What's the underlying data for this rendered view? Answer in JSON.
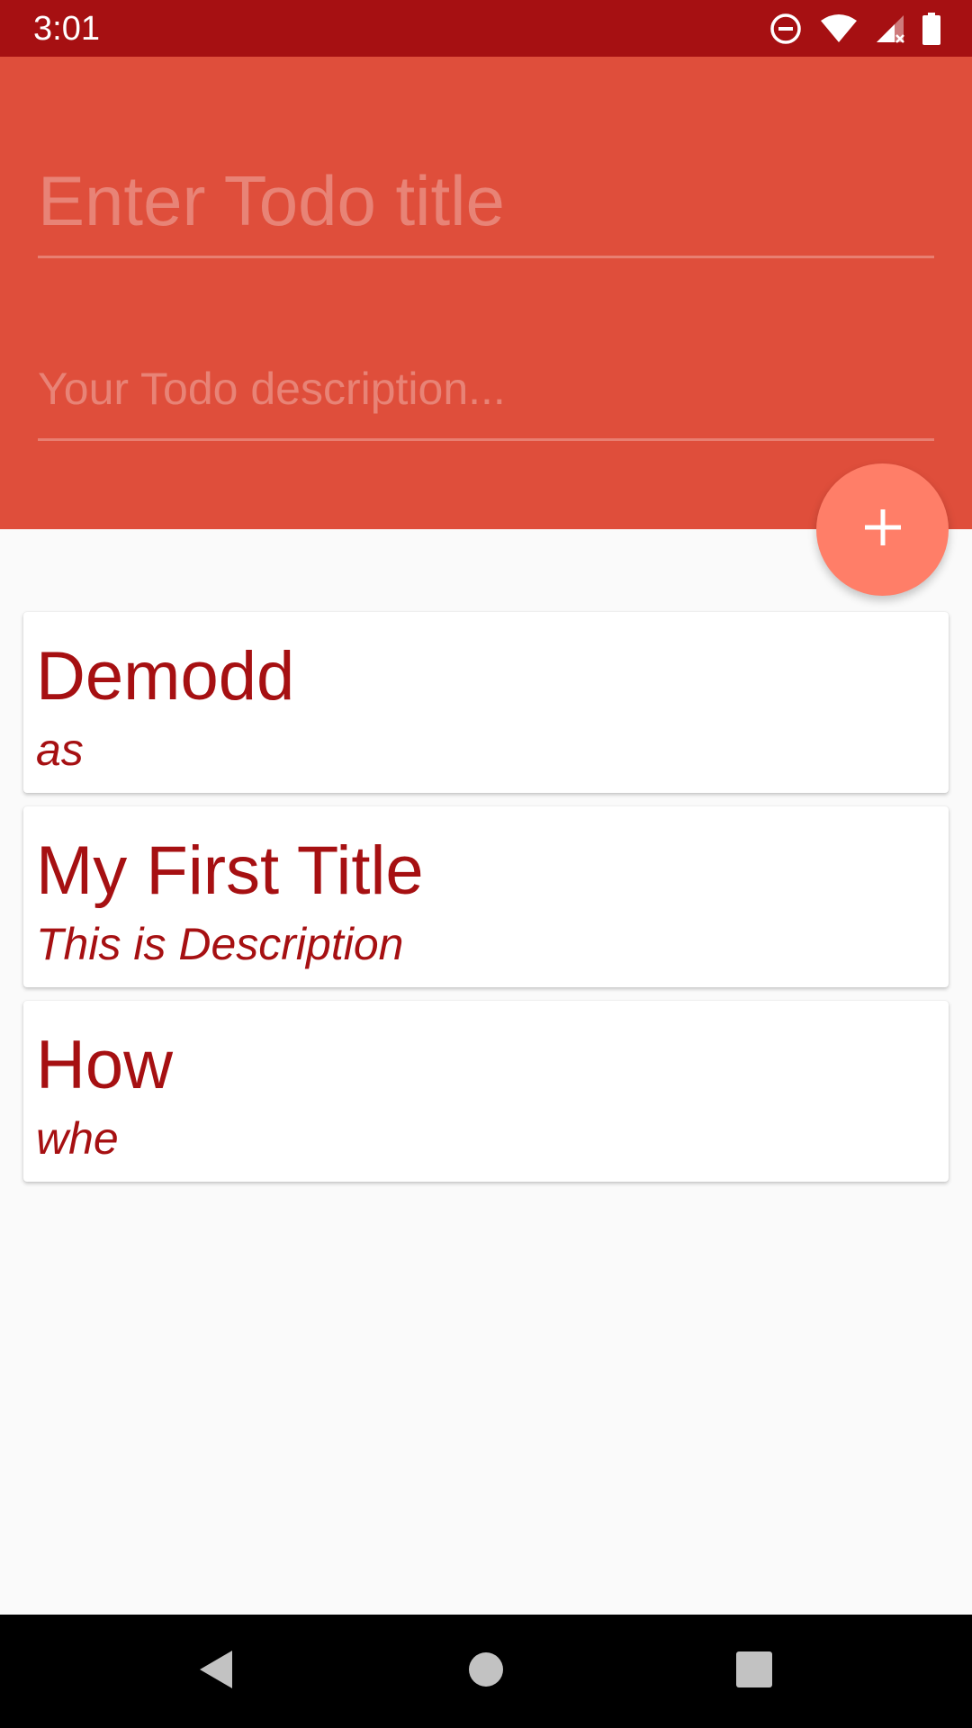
{
  "status_bar": {
    "time": "3:01",
    "icons": [
      "do-not-disturb-icon",
      "wifi-icon",
      "cell-signal-no-data-icon",
      "battery-icon"
    ],
    "background_color": "#a61012"
  },
  "form": {
    "title_placeholder": "Enter Todo title",
    "title_value": "",
    "description_placeholder": "Your Todo description...",
    "description_value": "",
    "background_color": "#df4e3b"
  },
  "fab": {
    "icon": "plus-icon",
    "color": "#ff7e68"
  },
  "todos": [
    {
      "title": "Demodd",
      "description": "as"
    },
    {
      "title": "My First Title",
      "description": "This is Description"
    },
    {
      "title": "How",
      "description": "whe"
    }
  ],
  "todo_text_color": "#a61012",
  "navigation_bar": {
    "buttons": [
      "back-icon",
      "home-icon",
      "recents-icon"
    ]
  }
}
